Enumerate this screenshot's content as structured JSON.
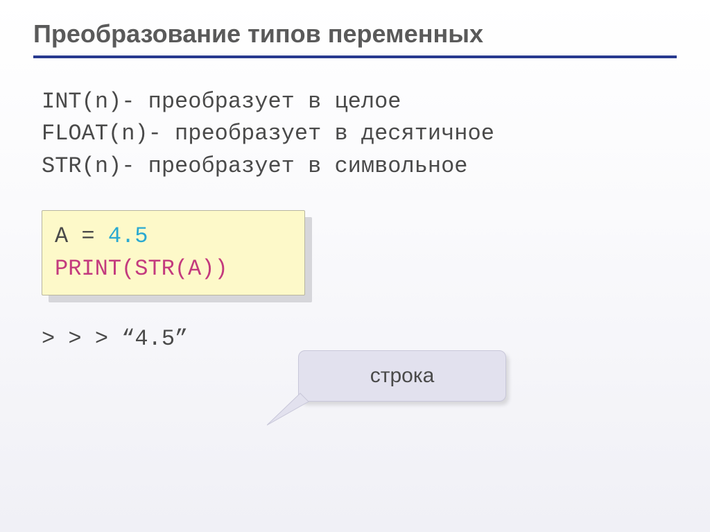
{
  "title": "Преобразование типов  переменных",
  "lines": {
    "l1_fn": "Int",
    "l1_arg": "(n)",
    "l1_desc": "- преобразует в целое",
    "l2_fn": "Float",
    "l2_arg": "(n)",
    "l2_desc": "- преобразует в десятичное",
    "l3_fn": "Str",
    "l3_arg": "(n)",
    "l3_desc": "- преобразует в символьное"
  },
  "code": {
    "line1_var": "a",
    "line1_op": " = ",
    "line1_num": "4.5",
    "line2_kw": "Print",
    "line2_paren_open": "(",
    "line2_fn": "str",
    "line2_inner": "(a)",
    "line2_paren_close": ")"
  },
  "output": "> > > “4.5”",
  "callout": "строка"
}
